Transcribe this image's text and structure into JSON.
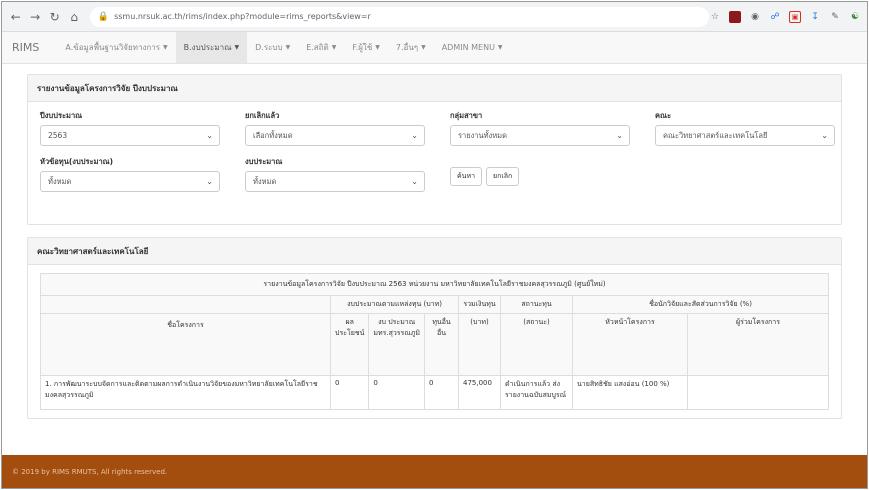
{
  "browser": {
    "url": "ssmu.nrsuk.ac.th/rims/index.php?module=rims_reports&view=r"
  },
  "navbar": {
    "brand": "RIMS",
    "menu": [
      {
        "label": "A.ข้อมูลพื้นฐานวิจัยทางการ",
        "active": false
      },
      {
        "label": "B.งบประมาณ",
        "active": true
      },
      {
        "label": "D.ระบบ",
        "active": false
      },
      {
        "label": "E.สถิติ",
        "active": false
      },
      {
        "label": "F.ผู้ใช้",
        "active": false
      },
      {
        "label": "7.อื่นๆ",
        "active": false
      },
      {
        "label": "ADMIN MENU",
        "active": false
      }
    ]
  },
  "filter_panel": {
    "title": "รายงานข้อมูลโครงการวิจัย ปีงบประมาณ",
    "fields": [
      {
        "label": "ปีงบประมาณ",
        "value": "2563"
      },
      {
        "label": "ยกเลิกแล้ว",
        "value": "เลือกทั้งหมด"
      },
      {
        "label": "กลุ่มสาขา",
        "value": "รายงานทั้งหมด"
      },
      {
        "label": "คณะ",
        "value": "คณะวิทยาศาสตร์และเทคโนโลยี"
      },
      {
        "label": "หัวข้อทุน(งบประมาณ)",
        "value": "ทั้งหมด"
      },
      {
        "label": "งบประมาณ",
        "value": "ทั้งหมด"
      }
    ],
    "buttons": {
      "search": "ค้นหา",
      "cancel": "ยกเลิก"
    }
  },
  "result_panel": {
    "title": "คณะวิทยาศาสตร์และเทคโนโลยี",
    "table_title": "รายงานข้อมูลโครงการวิจัย ปีงบประมาณ 2563 หน่วยงาน มหาวิทยาลัยเทคโนโลยีราชมงคลสุวรรณภูมิ (ศูนย์ใหม่)",
    "group_headers": {
      "budget": "งบประมาณตามแหล่งทุน (บาท)",
      "total": "รวมเงินทุน",
      "status": "สถานะทุน",
      "researchers": "ชื่อนักวิจัยและสัดส่วนการวิจัย (%)"
    },
    "sub_headers": {
      "project_name": "ชื่อโครงการ",
      "col1": "ผล ประโยชน์",
      "col2": "งบ ประมาณ มทร.สุวรรณภูมิ",
      "col3": "ทุนอื่น อื่น",
      "total_unit": "(บาท)",
      "status_unit": "(สถานะ)",
      "head": "หัวหน้าโครงการ",
      "members": "ผู้ร่วมโครงการ"
    },
    "rows": [
      {
        "project": "1. การพัฒนาระบบจัดการและติดตามผลการดำเนินงานวิจัยของมหาวิทยาลัยเทคโนโลยีราชมงคลสุวรรณภูมิ",
        "col1": "0",
        "col2": "0",
        "col3": "0",
        "total": "475,000",
        "status": "ดำเนินการแล้ว ส่งรายงานฉบับสมบูรณ์",
        "head": "นายสิทธิชัย แสงอ่อน (100 %)",
        "members": ""
      }
    ]
  },
  "footer": {
    "text": "© 2019 by RIMS RMUTS, All rights reserved."
  }
}
